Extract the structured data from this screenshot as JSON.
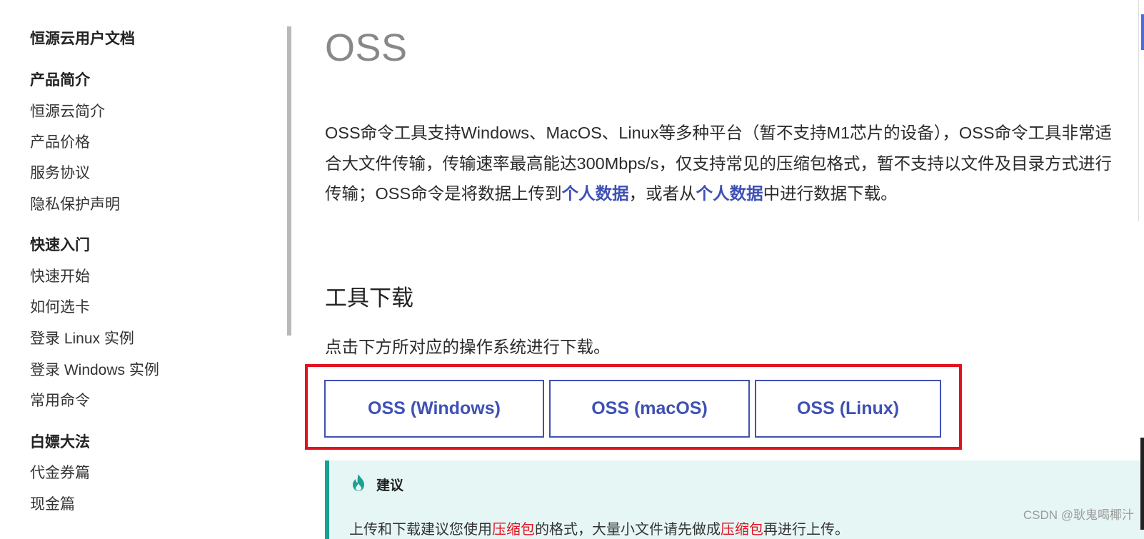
{
  "sidebar": {
    "title": "恒源云用户文档",
    "groups": [
      {
        "label": "产品简介",
        "items": [
          "恒源云简介",
          "产品价格",
          "服务协议",
          "隐私保护声明"
        ]
      },
      {
        "label": "快速入门",
        "items": [
          "快速开始",
          "如何选卡",
          "登录 Linux 实例",
          "登录 Windows 实例",
          "常用命令"
        ]
      },
      {
        "label": "白嫖大法",
        "items": [
          "代金券篇",
          "现金篇"
        ]
      }
    ]
  },
  "main": {
    "title": "OSS",
    "intro": {
      "part1": "OSS命令工具支持Windows、MacOS、Linux等多种平台（暂不支持M1芯片的设备），OSS命令工具非常适合大文件传输，传输速率最高能达300Mbps/s，仅支持常见的压缩包格式，暂不支持以文件及目录方式进行传输；OSS命令是将数据上传到",
      "link1": "个人数据",
      "part2": "，或者从",
      "link2": "个人数据",
      "part3": "中进行数据下载。"
    },
    "section_title": "工具下载",
    "instruction": "点击下方所对应的操作系统进行下载。",
    "downloads": [
      "OSS (Windows)",
      "OSS (macOS)",
      "OSS (Linux)"
    ],
    "tip": {
      "label": "建议",
      "body_part1": "上传和下载建议您使用",
      "body_hl1": "压缩包",
      "body_part2": "的格式，大量小文件请先做成",
      "body_hl2": "压缩包",
      "body_part3": "再进行上传。"
    }
  },
  "watermark": "CSDN @耿鬼喝椰汁",
  "colors": {
    "link": "#3f51b5",
    "highlight_box": "#e1131f",
    "tip_bg": "#e6f6f4",
    "tip_accent": "#1aa192"
  },
  "icons": {
    "tip": "fire-icon"
  }
}
